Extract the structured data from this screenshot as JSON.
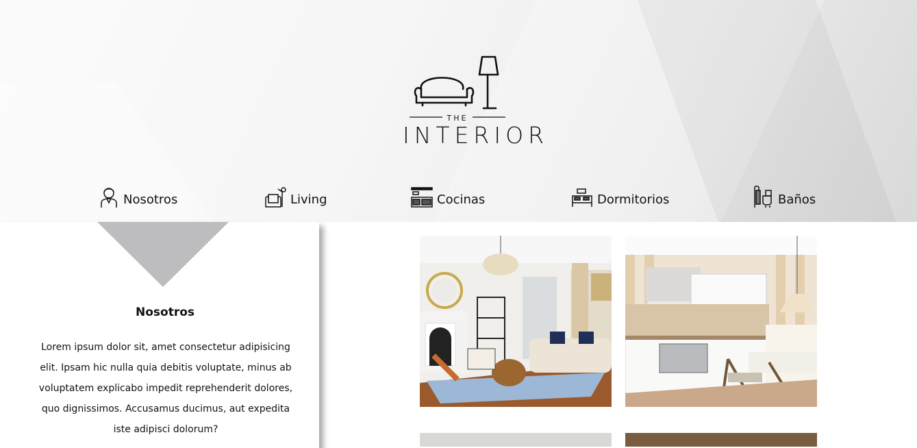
{
  "brand": {
    "the": "THE",
    "name": "INTERIOR"
  },
  "nav": [
    {
      "label": "Nosotros",
      "icon": "person-icon"
    },
    {
      "label": "Living",
      "icon": "armchair-lamp-icon"
    },
    {
      "label": "Cocinas",
      "icon": "kitchen-icon"
    },
    {
      "label": "Dormitorios",
      "icon": "bed-icon"
    },
    {
      "label": "Baños",
      "icon": "bathroom-icon"
    }
  ],
  "about": {
    "title": "Nosotros",
    "text": "Lorem ipsum dolor sit, amet consectetur adipisicing elit. Ipsam hic nulla quia debitis voluptate, minus ab voluptatem explicabo impedit reprehenderit dolores, quo dignissimos. Accusamus ducimus, aut expedita iste adipisci dolorum?"
  },
  "gallery": [
    {
      "name": "living-room-photo"
    },
    {
      "name": "kitchen-photo"
    }
  ],
  "colors": {
    "triangle": "#bdbdbf",
    "text": "#111111"
  }
}
